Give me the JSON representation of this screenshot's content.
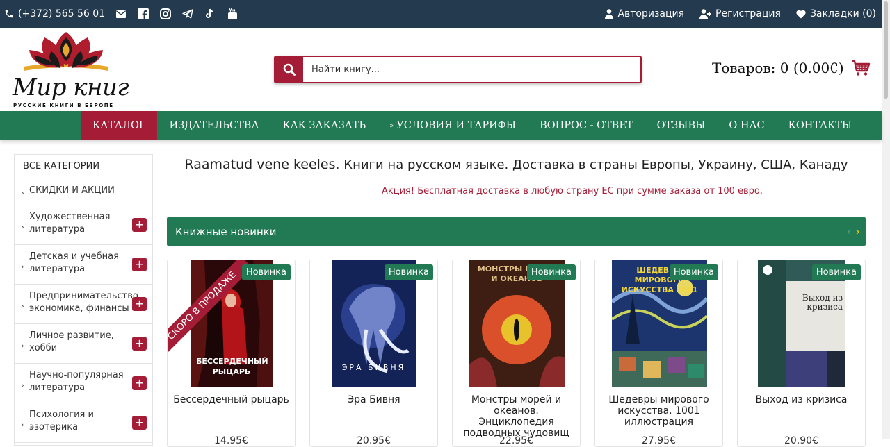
{
  "topbar": {
    "phone": "(+372) 565 56 01",
    "social_icons": [
      "mail-icon",
      "facebook-icon",
      "instagram-icon",
      "telegram-icon",
      "tiktok-icon",
      "youtube-icon"
    ],
    "login": "Авторизация",
    "register": "Регистрация",
    "bookmarks": "Закладки (0)"
  },
  "logo": {
    "text": "Мир книг",
    "subtitle": "РУССКИЕ КНИГИ В ЕВРОПЕ"
  },
  "search": {
    "placeholder": "Найти книгу..."
  },
  "cart": {
    "label": "Товаров: 0 (0.00€)"
  },
  "nav": {
    "items": [
      {
        "label": "КАТАЛОГ"
      },
      {
        "label": "ИЗДАТЕЛЬСТВА"
      },
      {
        "label": "КАК ЗАКАЗАТЬ"
      },
      {
        "label": "УСЛОВИЯ И ТАРИФЫ"
      },
      {
        "label": "ВОПРОС - ОТВЕТ"
      },
      {
        "label": "ОТЗЫВЫ"
      },
      {
        "label": "О НАС"
      },
      {
        "label": "КОНТАКТЫ"
      }
    ]
  },
  "sidebar": {
    "title": "ВСЕ КАТЕГОРИИ",
    "categories": [
      {
        "label": "СКИДКИ И АКЦИИ"
      },
      {
        "label": "Художественная литература"
      },
      {
        "label": "Детская и учебная литература"
      },
      {
        "label": "Предпринимательство, экономика, финансы"
      },
      {
        "label": "Личное развитие, хобби"
      },
      {
        "label": "Научно-популярная литература"
      },
      {
        "label": "Психология и эзотерика"
      }
    ]
  },
  "main": {
    "title_latin": "Raamatud vene keeles.",
    "title_rest": "Книги на русском языке. Доставка в страны Европы, Украину, США, Канаду",
    "promo": "Акция! Бесплатная доставка в любую страну ЕС при сумме заказа от 100 евро.",
    "section_title": "Книжные новинки"
  },
  "products": [
    {
      "badge": "Новинка",
      "title": "Бессердечный рыцарь",
      "ribbon": "СКОРО В ПРОДАЖЕ",
      "cover_text": "БЕССЕРДЕЧНЫЙ РЫЦАРЬ",
      "price": "14.95€"
    },
    {
      "badge": "Новинка",
      "title": "Эра Бивня",
      "cover_text": "ЭРА БИВНЯ",
      "price": "20.95€"
    },
    {
      "badge": "Новинка",
      "title": "Монстры морей и океанов. Энциклопедия подводных чудовищ",
      "cover_text": "МОНСТРЫ МОРЕЙ И ОКЕАНОВ",
      "price": "22.95€"
    },
    {
      "badge": "Новинка",
      "title": "Шедевры мирового искусства. 1001 иллюстрация",
      "cover_text": "ШЕДЕВРЫ МИРОВОГО ИСКУССТВА 1001",
      "price": "27.95€"
    },
    {
      "badge": "Новинка",
      "title": "Выход из кризиса",
      "cover_text": "Выход из кризиса",
      "price": "20.90€"
    }
  ],
  "colors": {
    "topbar": "#233a4f",
    "accent": "#a51c36",
    "green": "#227a54"
  }
}
